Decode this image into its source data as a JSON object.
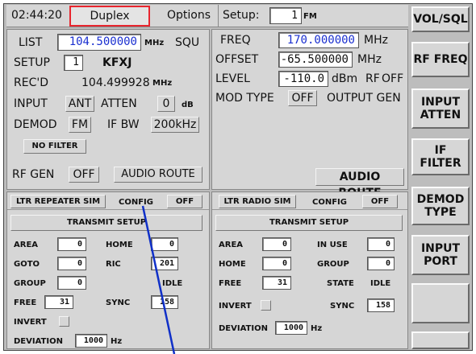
{
  "header": {
    "time": "02:44:20",
    "mode": "Duplex",
    "options": "Options",
    "setup_label": "Setup:",
    "setup_value": "1",
    "setup_unit": "FM"
  },
  "softkeys": [
    "VOL/SQL",
    "RF FREQ",
    "INPUT ATTEN",
    "IF FILTER",
    "DEMOD TYPE",
    "INPUT PORT",
    "",
    ""
  ],
  "rx": {
    "list_label": "LIST",
    "list_value": "104.500000",
    "list_unit": "MHz",
    "squ": "SQU",
    "setup_label": "SETUP",
    "setup_value": "1",
    "setup_name": "KFXJ",
    "recd_label": "REC'D",
    "recd_value": "104.499928",
    "recd_unit": "MHz",
    "input_label": "INPUT",
    "input_value": "ANT",
    "atten_label": "ATTEN",
    "atten_value": "0",
    "atten_unit": "dB",
    "demod_label": "DEMOD",
    "demod_value": "FM",
    "ifbw_label": "IF BW",
    "ifbw_value": "200kHz",
    "no_filter": "NO FILTER",
    "rfgen_label": "RF GEN",
    "rfgen_value": "OFF",
    "audio_route": "AUDIO ROUTE"
  },
  "tx": {
    "freq_label": "FREQ",
    "freq_value": "170.000000",
    "freq_unit": "MHz",
    "offset_label": "OFFSET",
    "offset_value": "-65.500000",
    "offset_unit": "MHz",
    "level_label": "LEVEL",
    "level_value": "-110.0",
    "level_unit": "dBm",
    "rf_label": "RF",
    "rf_value": "OFF",
    "modtype_label": "MOD TYPE",
    "modtype_value": "OFF",
    "output_gen": "OUTPUT GEN",
    "audio_route": "AUDIO ROUTE"
  },
  "ltr_repeater": {
    "title": "LTR REPEATER SIM",
    "config": "CONFIG",
    "state": "OFF",
    "transmit_setup": "TRANSMIT SETUP",
    "area_label": "AREA",
    "area_value": "0",
    "home_label": "HOME",
    "home_value": "0",
    "goto_label": "GOTO",
    "goto_value": "0",
    "ric_label": "RIC",
    "ric_value": "201",
    "group_label": "GROUP",
    "group_value": "0",
    "idle": "IDLE",
    "free_label": "FREE",
    "free_value": "31",
    "sync_label": "SYNC",
    "sync_value": "158",
    "invert_label": "INVERT",
    "deviation_label": "DEVIATION",
    "deviation_value": "1000",
    "deviation_unit": "Hz"
  },
  "ltr_radio": {
    "title": "LTR RADIO SIM",
    "config": "CONFIG",
    "state": "OFF",
    "transmit_setup": "TRANSMIT SETUP",
    "area_label": "AREA",
    "area_value": "0",
    "inuse_label": "IN USE",
    "inuse_value": "0",
    "home_label": "HOME",
    "home_value": "0",
    "group_label": "GROUP",
    "group_value": "0",
    "free_label": "FREE",
    "free_value": "31",
    "state_label": "STATE",
    "state_value": "IDLE",
    "invert_label": "INVERT",
    "sync_label": "SYNC",
    "sync_value": "158",
    "deviation_label": "DEVIATION",
    "deviation_value": "1000",
    "deviation_unit": "Hz"
  },
  "colors": {
    "panel": "#d6d6d6",
    "highlight": "#e8252e",
    "value_blue": "#1a2fd0",
    "pointer_line": "#1030c8"
  }
}
